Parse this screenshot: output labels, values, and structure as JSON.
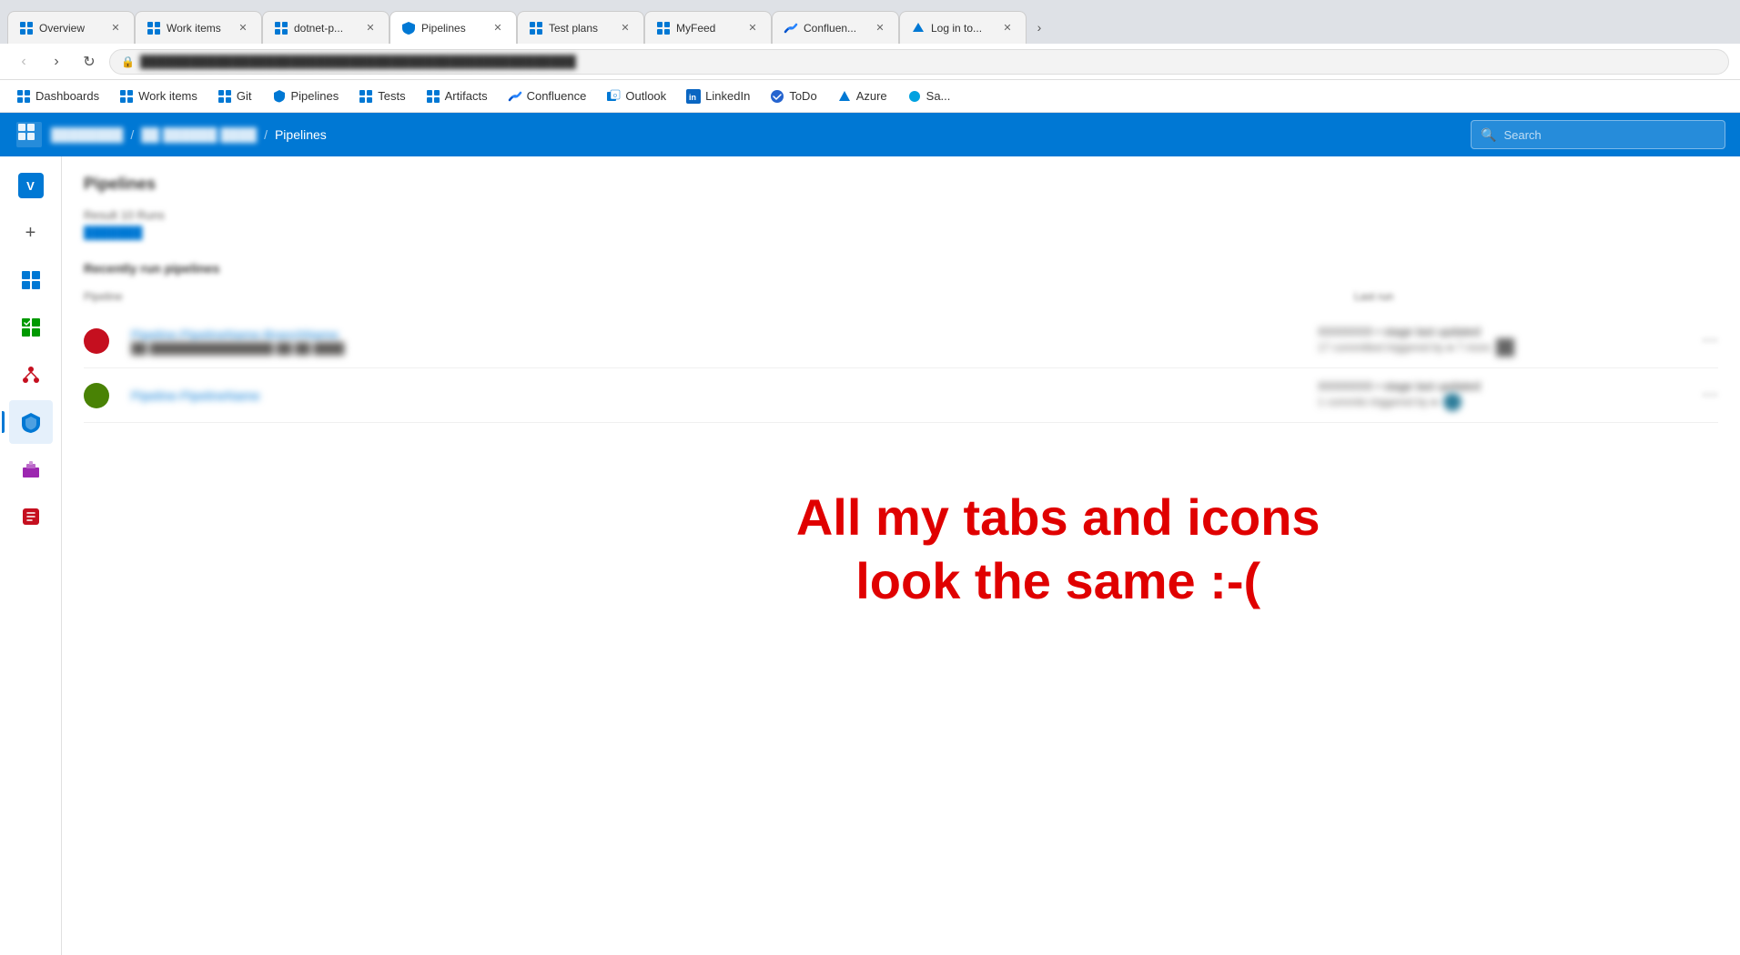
{
  "browser": {
    "tabs": [
      {
        "id": "overview",
        "label": "Overview",
        "active": false,
        "icon": "ado"
      },
      {
        "id": "workitems",
        "label": "Work items",
        "active": false,
        "icon": "ado"
      },
      {
        "id": "dotnet",
        "label": "dotnet-p...",
        "active": false,
        "icon": "ado"
      },
      {
        "id": "pipelines",
        "label": "Pipelines",
        "active": true,
        "icon": "ado"
      },
      {
        "id": "testplans",
        "label": "Test plans",
        "active": false,
        "icon": "ado"
      },
      {
        "id": "myfeed",
        "label": "MyFeed",
        "active": false,
        "icon": "ado"
      },
      {
        "id": "confluence",
        "label": "Confluen...",
        "active": false,
        "icon": "confluence"
      },
      {
        "id": "loginto",
        "label": "Log in to...",
        "active": false,
        "icon": "azure"
      }
    ],
    "url": "████████████████████████████████████████"
  },
  "bookmarks": [
    {
      "id": "dashboards",
      "label": "Dashboards",
      "icon": "ado"
    },
    {
      "id": "workitems",
      "label": "Work items",
      "icon": "ado"
    },
    {
      "id": "git",
      "label": "Git",
      "icon": "ado"
    },
    {
      "id": "pipelines",
      "label": "Pipelines",
      "icon": "ado"
    },
    {
      "id": "tests",
      "label": "Tests",
      "icon": "ado"
    },
    {
      "id": "artifacts",
      "label": "Artifacts",
      "icon": "ado"
    },
    {
      "id": "confluence",
      "label": "Confluence",
      "icon": "confluence"
    },
    {
      "id": "outlook",
      "label": "Outlook",
      "icon": "outlook"
    },
    {
      "id": "linkedin",
      "label": "LinkedIn",
      "icon": "linkedin"
    },
    {
      "id": "todo",
      "label": "ToDo",
      "icon": "todo"
    },
    {
      "id": "azure",
      "label": "Azure",
      "icon": "azure"
    },
    {
      "id": "sa",
      "label": "Sa...",
      "icon": "salesforce"
    }
  ],
  "topnav": {
    "breadcrumb_org": "████████",
    "breadcrumb_project": "██ ██████ ████",
    "breadcrumb_current": "Pipelines",
    "search_placeholder": "Search"
  },
  "sidebar": {
    "avatar_initials": "V",
    "items": [
      {
        "id": "avatar",
        "type": "avatar"
      },
      {
        "id": "add",
        "type": "plus"
      },
      {
        "id": "boards",
        "type": "icon",
        "icon": "boards"
      },
      {
        "id": "testplans",
        "type": "icon",
        "icon": "testplans"
      },
      {
        "id": "repos",
        "type": "icon",
        "icon": "repos"
      },
      {
        "id": "pipelines",
        "type": "icon",
        "icon": "pipelines",
        "active": true
      },
      {
        "id": "artifacts",
        "type": "icon",
        "icon": "artifacts"
      },
      {
        "id": "redicon",
        "type": "icon",
        "icon": "red"
      }
    ]
  },
  "content": {
    "title": "Pipelines",
    "result_count_label": "Result  10  Runs",
    "filter_link": "███████",
    "recently_run_label": "Recently run pipelines",
    "col_pipeline": "Pipeline",
    "col_last_run": "Last run",
    "pipelines": [
      {
        "id": "p1",
        "icon_color": "#c50f1f",
        "name": "Pipeline-PipelineName-BranchName",
        "status": "███████████",
        "meta": "██ ████████████████ ██  ██ ████",
        "last_run_title": "XXXXXXX • stage last updated",
        "last_run_meta": "17 committed triggered by  ● 7 more",
        "avatar_color": "#666"
      },
      {
        "id": "p2",
        "icon_color": "#498205",
        "name": "Pipeline-PipelineName",
        "status": "███████████",
        "meta": "",
        "last_run_title": "XXXXXXX • stage last updated",
        "last_run_meta": "1 commits triggered by ●",
        "avatar_color": "#2d7d9a"
      }
    ]
  },
  "overlay": {
    "line1": "All my tabs and icons",
    "line2": "look the same :-("
  }
}
